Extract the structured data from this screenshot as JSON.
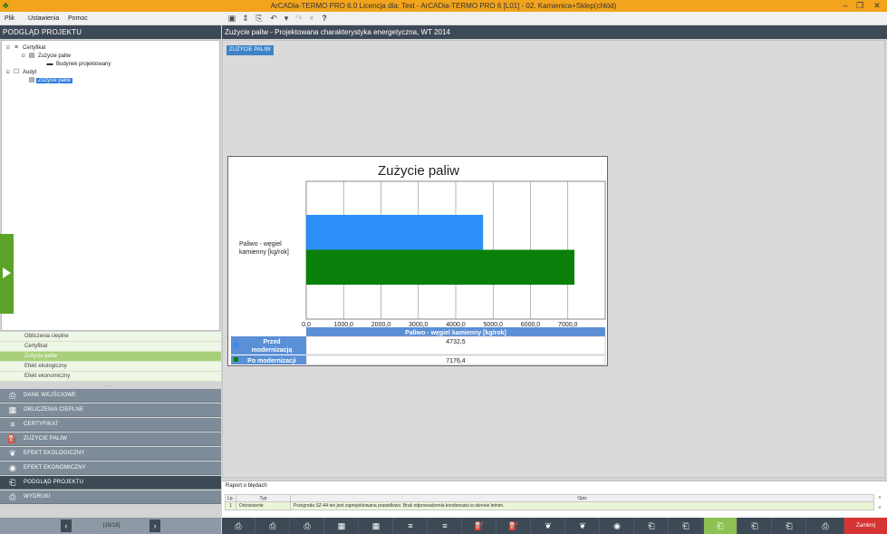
{
  "window": {
    "title": "ArCADia-TERMO PRO 6.0 Licencja dla: Test - ArCADia-TERMO PRO 6 [L01] - 02. Kamienica+Sklep(chłód)",
    "min": "–",
    "max": "❐",
    "close": "✕"
  },
  "menu": {
    "file": "Plik",
    "settings": "Ustawienia",
    "help": "Pomoc"
  },
  "left_panel": {
    "header": "PODGLĄD PROJEKTU",
    "tree": [
      {
        "label": "Certyfikat"
      },
      {
        "label": "Zużycie paliw"
      },
      {
        "label": "Budynek projektowany"
      },
      {
        "label": "Audyt"
      },
      {
        "label": "Zużycie paliw"
      }
    ],
    "subitems": [
      "Obliczenia cieplne",
      "Certyfikat",
      "Zużycie paliw",
      "Efekt ekologiczny",
      "Efekt ekonomiczny"
    ],
    "dots": ".....",
    "nav": [
      "DANE WEJŚCIOWE",
      "OBLICZENIA CIEPLNE",
      "CERTYFIKAT",
      "ZUŻYCIE PALIW",
      "EFEKT EKOLOGICZNY",
      "EFEKT EKONOMICZNY",
      "PODGLĄD PROJEKTU",
      "WYDRUKI"
    ],
    "pager": {
      "text": "[15/18]",
      "prev": "‹",
      "next": "›"
    }
  },
  "right_panel": {
    "header": "Zużycie paliw - Projektowana charakterystyka energetyczna, WT 2014",
    "section_tag": "ZUŻYCIE PALIW"
  },
  "chart_data": {
    "type": "bar",
    "orientation": "horizontal",
    "title": "Zużycie paliw",
    "categories": [
      "Paliwo - węgiel kamienny [kg/rok]"
    ],
    "category_label_lines": [
      "Paliwo - węgiel",
      "kamienny [kg/rok]"
    ],
    "series": [
      {
        "name": "Przed modernizacją",
        "name_lines": [
          "Przed",
          "modernizacją"
        ],
        "values": [
          4732.5
        ],
        "value_label": "4732,5",
        "color": "#2a8ff7"
      },
      {
        "name": "Po modernizacji",
        "name_lines": [
          "Po modernizacji"
        ],
        "values": [
          7176.4
        ],
        "value_label": "7176,4",
        "color": "#0a800a"
      }
    ],
    "xlim": [
      0,
      8000
    ],
    "ticks": [
      0,
      1000,
      2000,
      3000,
      4000,
      5000,
      6000,
      7000
    ],
    "tick_labels": [
      "0,0",
      "1000,0",
      "2000,0",
      "3000,0",
      "4000,0",
      "5000,0",
      "6000,0",
      "7000,0"
    ],
    "grid": true,
    "legend": "table-bottom",
    "table_header": "Paliwo - węgiel kamienny [kg/rok]",
    "header_color": "#5b8fd6"
  },
  "report": {
    "title": "Raport o błędach",
    "columns": [
      "Lp.",
      "Typ",
      "Opis"
    ],
    "rows": [
      [
        "1",
        "Ostrzeżenie",
        "Przegroda SZ-44 nie jest zaprojektowana prawidłowo. Brak odprowadzenia kondensatu w okresie letnim."
      ]
    ]
  },
  "bottom": {
    "close": "Zamknij"
  }
}
